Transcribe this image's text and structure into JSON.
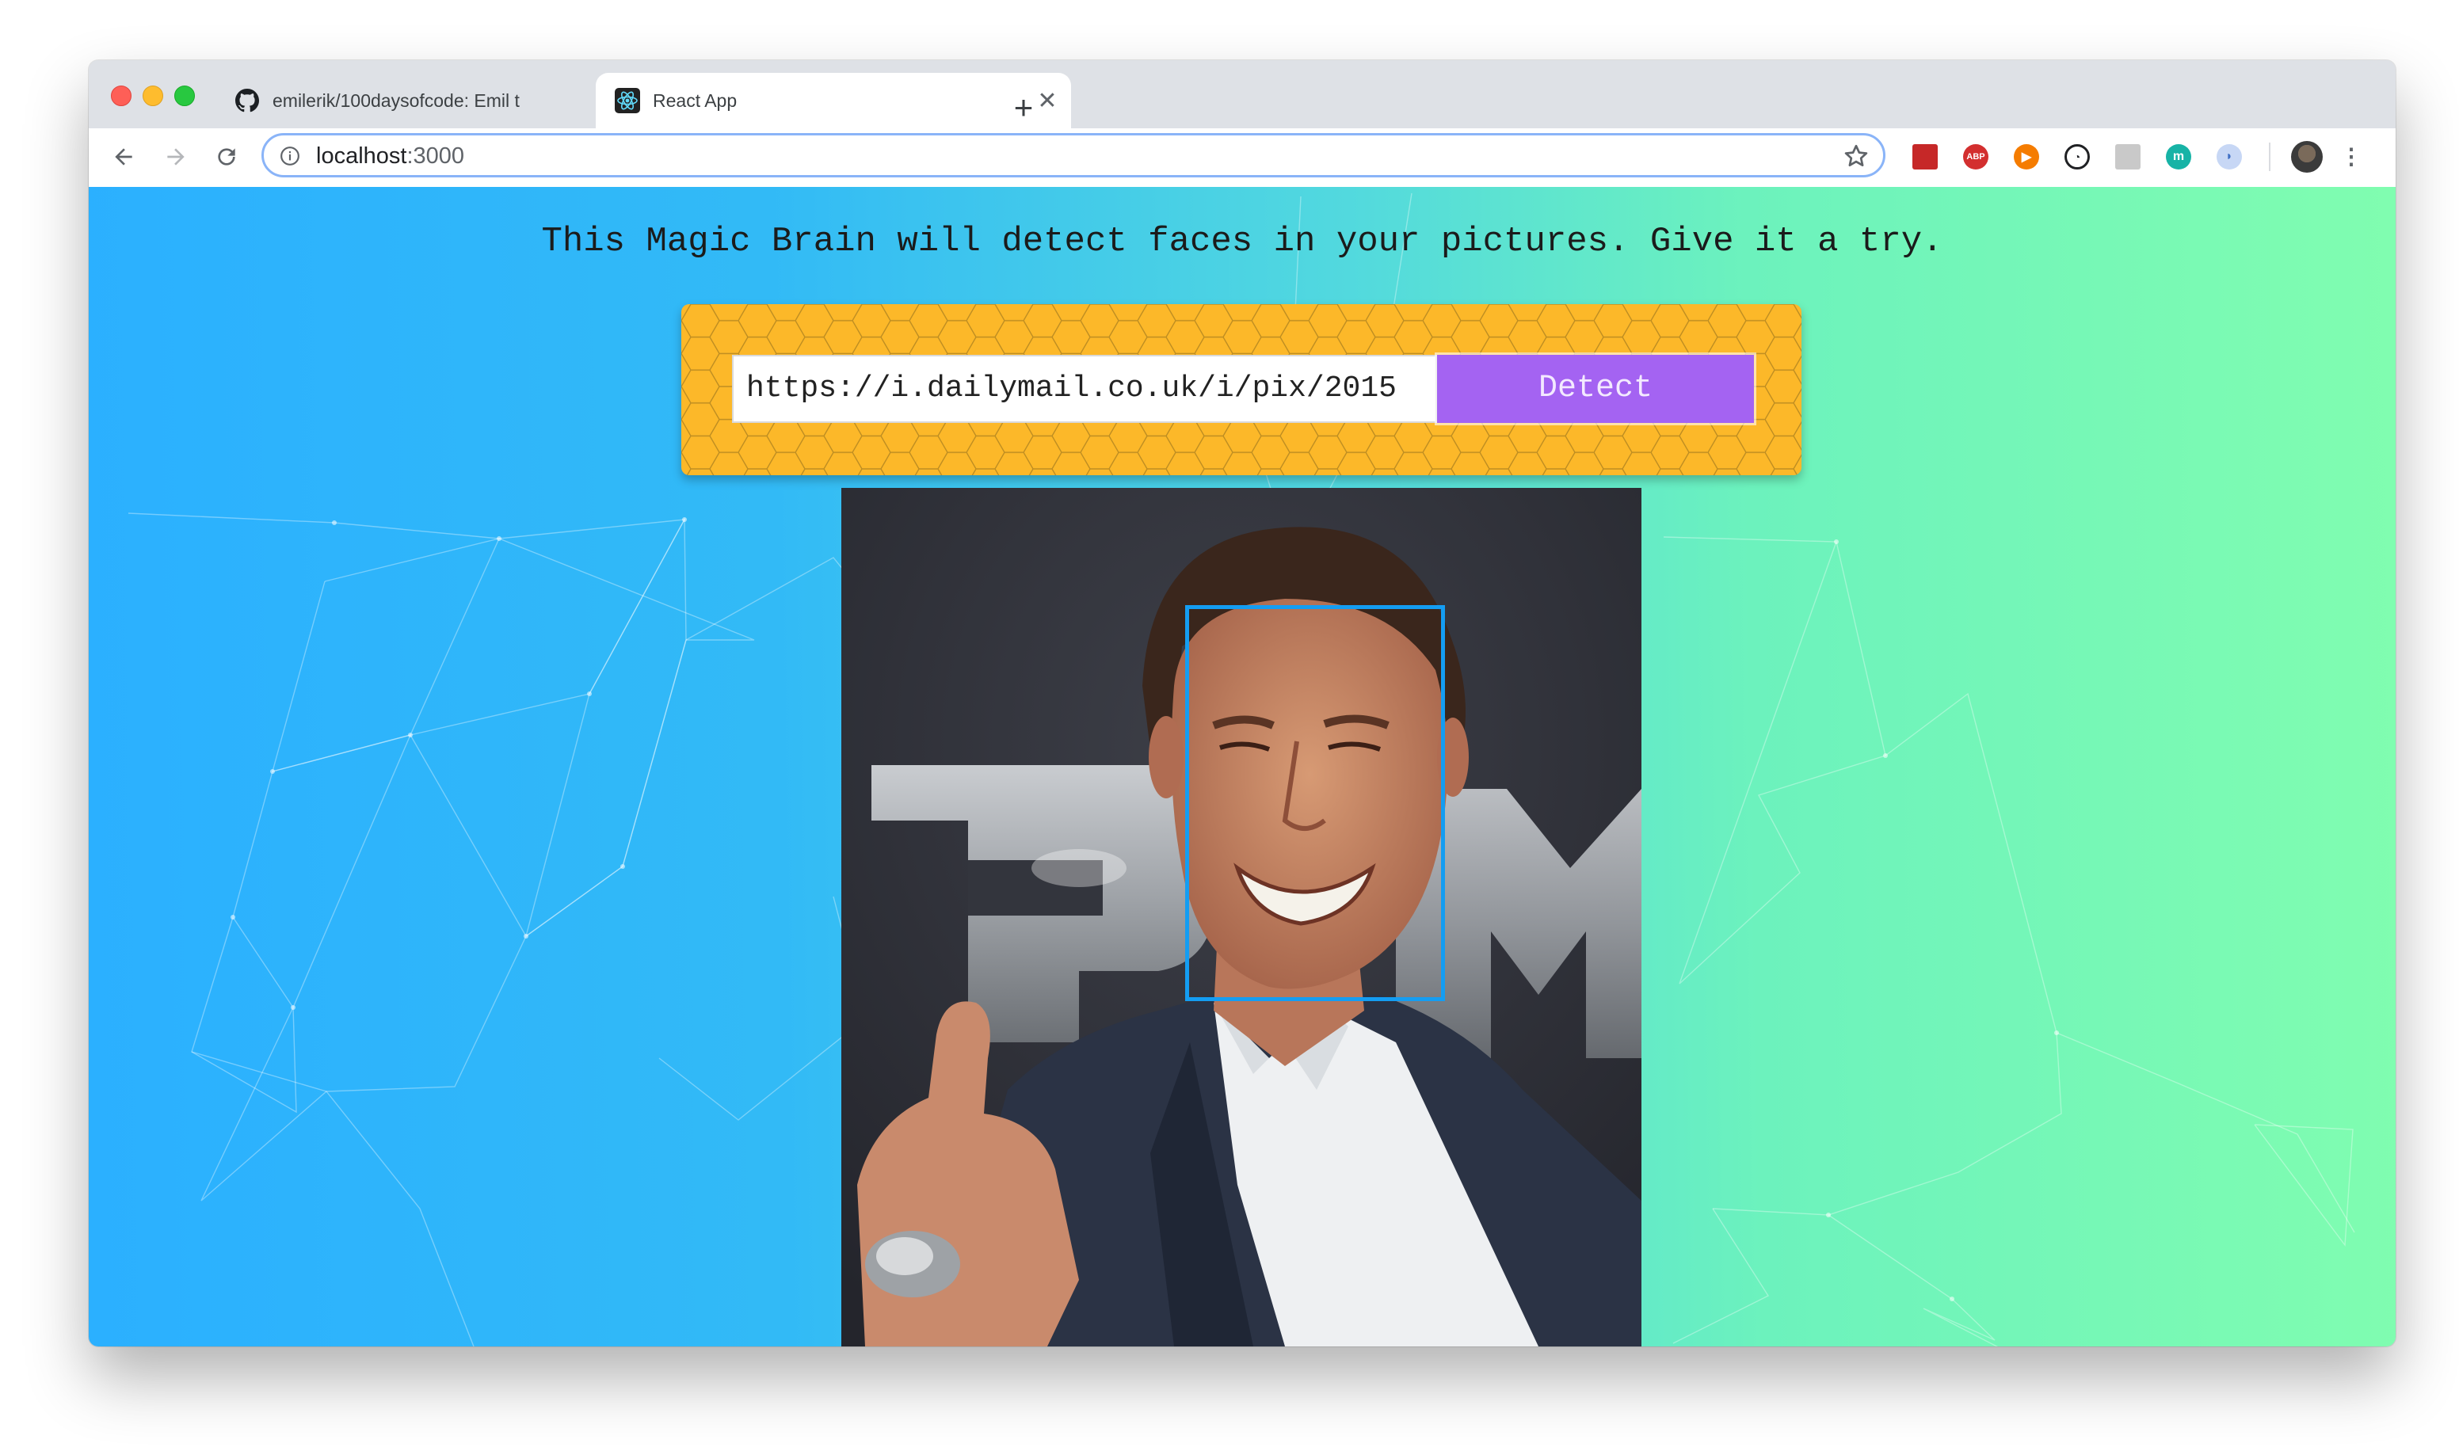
{
  "browser": {
    "tabs": [
      {
        "title": "emilerik/100daysofcode: Emil t",
        "favicon": "github-icon",
        "active": false
      },
      {
        "title": "React App",
        "favicon": "react-icon",
        "active": true
      }
    ],
    "url_host": "localhost",
    "url_port": ":3000",
    "extensions": [
      "red-book-icon",
      "adblock-plus-icon",
      "play-icon",
      "timer-icon",
      "page-icon",
      "teal-m-icon",
      "blue-shield-icon",
      "profile-avatar"
    ]
  },
  "app": {
    "tagline": "This Magic Brain will detect faces in your pictures. Give it a try.",
    "image_url_value": "https://i.dailymail.co.uk/i/pix/2015",
    "detect_label": "Detect",
    "colors": {
      "gradient_start": "#2bb0ff",
      "gradient_end": "#80fdb0",
      "card": "#fcb829",
      "button": "#a463f2",
      "face_box": "#149df2"
    }
  }
}
